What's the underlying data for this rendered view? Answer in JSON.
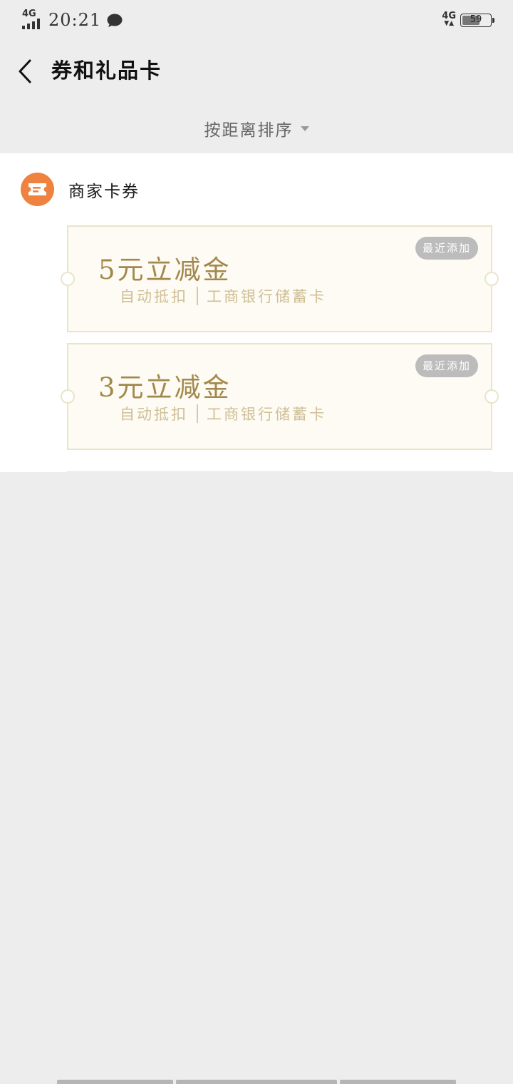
{
  "status_bar": {
    "network_left": "4G",
    "time": "20:21",
    "network_right": "4G",
    "battery": "59"
  },
  "header": {
    "title": "券和礼品卡"
  },
  "sort": {
    "label": "按距离排序"
  },
  "section": {
    "title": "商家卡券",
    "icon": "ticket-icon",
    "icon_color": "#f0823f"
  },
  "coupons": [
    {
      "tag": "最近添加",
      "amount": "5元立减金",
      "method": "自动抵扣",
      "card": "工商银行储蓄卡"
    },
    {
      "tag": "最近添加",
      "amount": "3元立减金",
      "method": "自动抵扣",
      "card": "工商银行储蓄卡"
    }
  ],
  "colors": {
    "accent": "#f0823f",
    "coupon_text": "#a2884b",
    "coupon_bg": "#fdfbf3"
  }
}
